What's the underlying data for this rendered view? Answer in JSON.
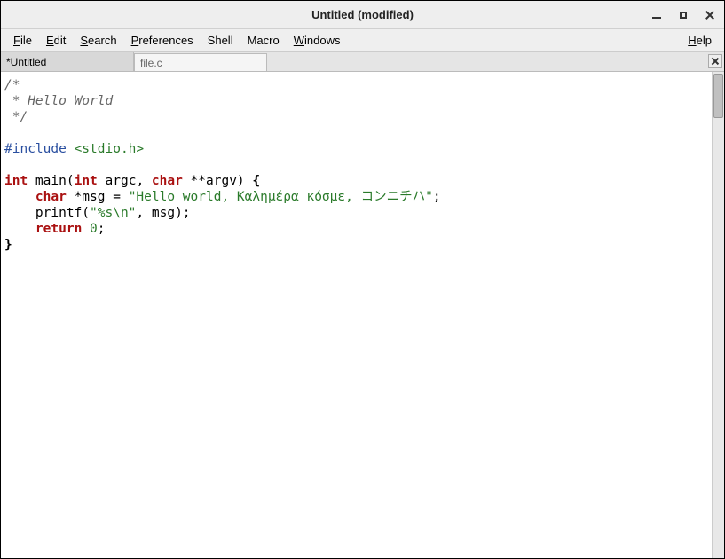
{
  "titlebar": {
    "title": "Untitled (modified)"
  },
  "menubar": {
    "file": "File",
    "edit": "Edit",
    "search": "Search",
    "preferences": "Preferences",
    "shell": "Shell",
    "macro": "Macro",
    "windows": "Windows",
    "help": "Help"
  },
  "tabs": {
    "items": [
      {
        "label": "*Untitled",
        "active": true
      },
      {
        "label": "file.c",
        "active": false
      }
    ]
  },
  "code": {
    "l1": "/*",
    "l2": " * Hello World",
    "l3": " */",
    "l4": "",
    "l5a": "#include",
    "l5b": " <stdio.h>",
    "l6": "",
    "l7_int": "int",
    "l7_main": " main(",
    "l7_int2": "int",
    "l7_argc": " argc, ",
    "l7_char": "char",
    "l7_argv": " **argv) ",
    "l7_brace": "{",
    "l8_indent": "    ",
    "l8_char": "char",
    "l8_msg": " *msg = ",
    "l8_str": "\"Hello world, Καλημέρα κόσμε, コンニチハ\"",
    "l8_semi": ";",
    "l9": "    printf(",
    "l9_str": "\"%s\\n\"",
    "l9_rest": ", msg);",
    "l10_indent": "    ",
    "l10_ret": "return",
    "l10_sp": " ",
    "l10_zero": "0",
    "l10_semi": ";",
    "l11": "}"
  }
}
